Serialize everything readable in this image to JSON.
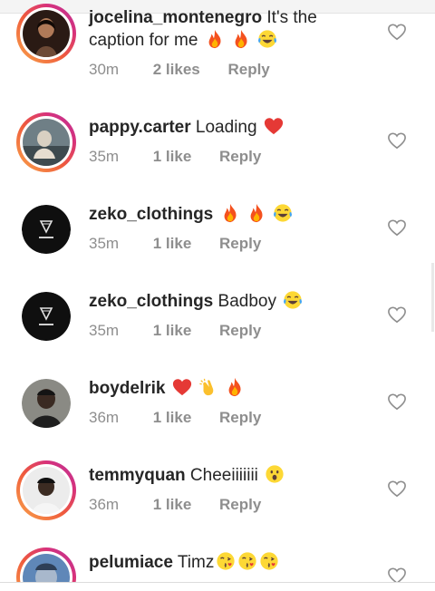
{
  "comments": [
    {
      "username": "jocelina_montenegro",
      "text": "It's the",
      "text2": "caption for me",
      "emojis": [
        "fire-emoji",
        "fire-emoji",
        "laughing-tears-emoji"
      ],
      "time": "30m",
      "likes": "2 likes",
      "reply": "Reply"
    },
    {
      "username": "pappy.carter",
      "text": "Loading",
      "emojis": [
        "red-heart-emoji"
      ],
      "time": "35m",
      "likes": "1 like",
      "reply": "Reply"
    },
    {
      "username": "zeko_clothings",
      "text": "",
      "emojis": [
        "fire-emoji",
        "fire-emoji",
        "laughing-tears-emoji"
      ],
      "time": "35m",
      "likes": "1 like",
      "reply": "Reply"
    },
    {
      "username": "zeko_clothings",
      "text": "Badboy",
      "emojis": [
        "laughing-tears-emoji"
      ],
      "time": "35m",
      "likes": "1 like",
      "reply": "Reply"
    },
    {
      "username": "boydelrik",
      "text": "",
      "emojis": [
        "red-heart-emoji",
        "clapping-hands-emoji",
        "fire-emoji"
      ],
      "time": "36m",
      "likes": "1 like",
      "reply": "Reply"
    },
    {
      "username": "temmyquan",
      "text": "Cheeiiiiiii",
      "emojis": [
        "astonished-face-emoji"
      ],
      "time": "36m",
      "likes": "1 like",
      "reply": "Reply"
    },
    {
      "username": "pelumiace",
      "text": "Timz",
      "emojis": [
        "kissing-heart-emoji",
        "kissing-heart-emoji",
        "kissing-heart-emoji"
      ],
      "time": "",
      "likes": "",
      "reply": ""
    }
  ],
  "icons": {
    "like": "heart-outline-icon"
  },
  "colors": {
    "username": "#262626",
    "meta": "#8e8e8e",
    "heart_outline": "#8e8e8e",
    "story_ring_start": "#f9a64b",
    "story_ring_end": "#b83599"
  }
}
